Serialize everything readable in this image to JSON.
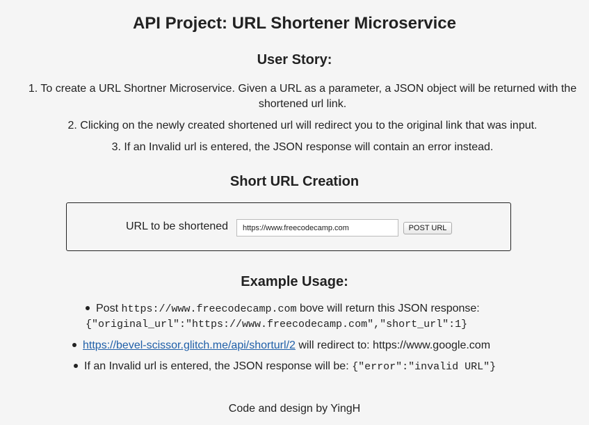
{
  "page": {
    "title": "API Project: URL Shortener Microservice"
  },
  "user_story": {
    "heading": "User Story:",
    "items": [
      "1. To create a URL Shortner Microservice. Given a URL as a parameter, a JSON object will be returned with the shortened url link.",
      "2. Clicking on the newly created shortened url will redirect you to the original link that was input.",
      "3. If an Invalid url is entered, the JSON response will contain an error instead."
    ]
  },
  "creation": {
    "heading": "Short URL Creation",
    "label": "URL to be shortened",
    "input_value": "https://www.freecodecamp.com",
    "button_label": "POST URL"
  },
  "examples": {
    "heading": "Example Usage:",
    "item1": {
      "prefix": "Post",
      "code_url": "https://www.freecodecamp.com",
      "middle": "bove will return this JSON response:",
      "json": "{\"original_url\":\"https://www.freecodecamp.com\",\"short_url\":1}"
    },
    "item2": {
      "link_text": "https://bevel-scissor.glitch.me/api/shorturl/2",
      "suffix": " will redirect to: https://www.google.com"
    },
    "item3": {
      "prefix": "If an Invalid url is entered, the JSON response will be:",
      "json": "{\"error\":\"invalid URL\"}"
    },
    "link_color": "#1f5fa8"
  },
  "footer": {
    "text": "Code and design by YingH"
  }
}
